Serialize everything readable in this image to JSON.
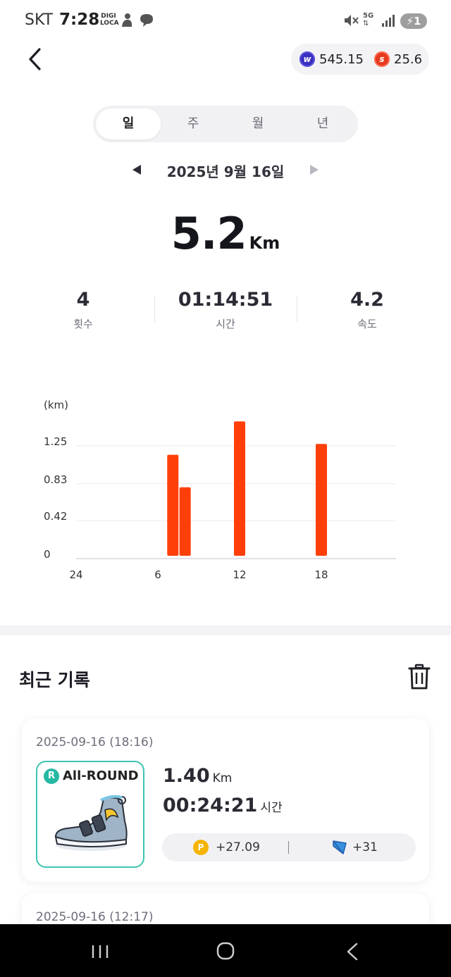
{
  "status_bar": {
    "carrier": "SKT",
    "time": "7:28",
    "digi_line1": "DIGI",
    "digi_line2": "LOCA",
    "network": "5G",
    "battery": "1"
  },
  "header": {
    "balance_w": "545.15",
    "balance_s": "25.6",
    "coin_w_letter": "w",
    "coin_s_letter": "s"
  },
  "tabs": [
    {
      "label": "일",
      "active": true
    },
    {
      "label": "주",
      "active": false
    },
    {
      "label": "월",
      "active": false
    },
    {
      "label": "년",
      "active": false
    }
  ],
  "date": "2025년 9월 16일",
  "summary": {
    "distance": "5.2",
    "unit": "Km",
    "stats": [
      {
        "value": "4",
        "label": "횟수"
      },
      {
        "value": "01:14:51",
        "label": "시간"
      },
      {
        "value": "4.2",
        "label": "속도"
      }
    ]
  },
  "chart_data": {
    "type": "bar",
    "ylabel": "(km)",
    "yticks": [
      "1.25",
      "0.83",
      "0.42",
      "0"
    ],
    "ylim": [
      0,
      1.25
    ],
    "xticks": [
      "24",
      "6",
      "12",
      "18"
    ],
    "xlim": [
      0,
      24
    ],
    "grid": true,
    "color": "#ff3f0a",
    "bars": [
      {
        "x": 7.1,
        "value": 1.12
      },
      {
        "x": 8.0,
        "value": 0.76
      },
      {
        "x": 12.0,
        "value": 1.49
      },
      {
        "x": 18.0,
        "value": 1.24
      }
    ]
  },
  "recent": {
    "title": "최근 기록",
    "records": [
      {
        "datetime": "2025-09-16 (18:16)",
        "badge": "R",
        "shoe_name": "All-ROUND",
        "distance": "1.40",
        "distance_unit": "Km",
        "duration": "00:24:21",
        "duration_unit": "시간",
        "points": "+27.09",
        "flags": "+31"
      },
      {
        "datetime": "2025-09-16 (12:17)"
      }
    ]
  },
  "colors": {
    "accent": "#ff3f0a",
    "teal": "#3ec4b1",
    "point": "#f5b400"
  }
}
